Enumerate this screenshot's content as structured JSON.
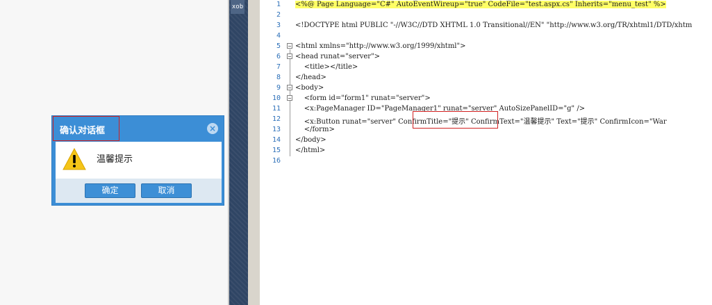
{
  "dialog": {
    "title": "确认对话框",
    "message": "温馨提示",
    "ok_label": "确定",
    "cancel_label": "取消",
    "close_symbol": "×",
    "accent_color": "#3c8ed6",
    "warning_icon": "warning-triangle-icon"
  },
  "sidebar": {
    "toolbox_label": "xob"
  },
  "editor": {
    "lines": [
      {
        "n": "1",
        "code": "<%@ Page Language=\"C#\" AutoEventWireup=\"true\" CodeFile=\"test.aspx.cs\" Inherits=\"menu_test\" %>"
      },
      {
        "n": "2",
        "code": ""
      },
      {
        "n": "3",
        "code": "<!DOCTYPE html PUBLIC \"-//W3C//DTD XHTML 1.0 Transitional//EN\" \"http://www.w3.org/TR/xhtml1/DTD/xhtm"
      },
      {
        "n": "4",
        "code": ""
      },
      {
        "n": "5",
        "code": "<html xmlns=\"http://www.w3.org/1999/xhtml\">"
      },
      {
        "n": "6",
        "code": "<head runat=\"server\">"
      },
      {
        "n": "7",
        "code": "    <title></title>"
      },
      {
        "n": "8",
        "code": "</head>"
      },
      {
        "n": "9",
        "code": "<body>"
      },
      {
        "n": "10",
        "code": "    <form id=\"form1\" runat=\"server\">"
      },
      {
        "n": "11",
        "code": "    <x:PageManager ID=\"PageManager1\" runat=\"server\" AutoSizePanelID=\"g\" />"
      },
      {
        "n": "12",
        "code": "    <x:Button runat=\"server\" ConfirmTitle=\"提示\" ConfirmText=\"温馨提示\" Text=\"提示\" ConfirmIcon=\"War"
      },
      {
        "n": "13",
        "code": "    </form>"
      },
      {
        "n": "14",
        "code": "</body>"
      },
      {
        "n": "15",
        "code": "</html>"
      },
      {
        "n": "16",
        "code": ""
      }
    ]
  }
}
